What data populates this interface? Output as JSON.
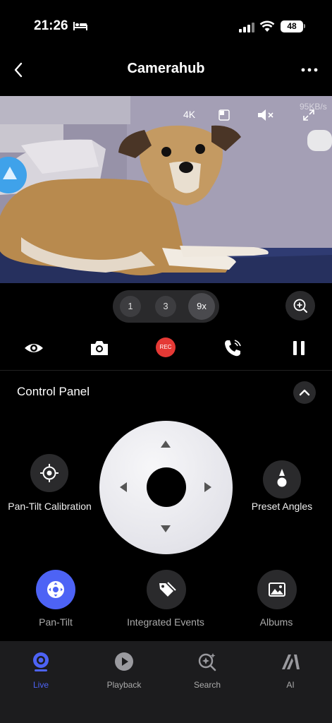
{
  "status_bar": {
    "time": "21:26",
    "battery": "48"
  },
  "nav": {
    "title": "Camerahub"
  },
  "video": {
    "resolution": "4K",
    "speed": "95KB/s"
  },
  "zoom": {
    "options": [
      "1",
      "3",
      "9x"
    ]
  },
  "actions": {
    "record_label": "REC"
  },
  "control_panel": {
    "title": "Control Panel",
    "calibration_label": "Pan-Tilt Calibration",
    "preset_label": "Preset Angles"
  },
  "features": [
    {
      "label": "Pan-Tilt",
      "icon": "pan-tilt-icon",
      "active": true
    },
    {
      "label": "Integrated Events",
      "icon": "tag-icon",
      "active": false
    },
    {
      "label": "Albums",
      "icon": "image-icon",
      "active": false
    }
  ],
  "tabs": [
    {
      "label": "Live",
      "icon": "live-camera-icon",
      "active": true
    },
    {
      "label": "Playback",
      "icon": "play-icon",
      "active": false
    },
    {
      "label": "Search",
      "icon": "search-sparkle-icon",
      "active": false
    },
    {
      "label": "AI",
      "icon": "ai-icon",
      "active": false
    }
  ],
  "colors": {
    "accent": "#4d63f5",
    "record": "#e53935",
    "panel": "#2a2a2c",
    "tabbar": "#1c1c1e"
  }
}
